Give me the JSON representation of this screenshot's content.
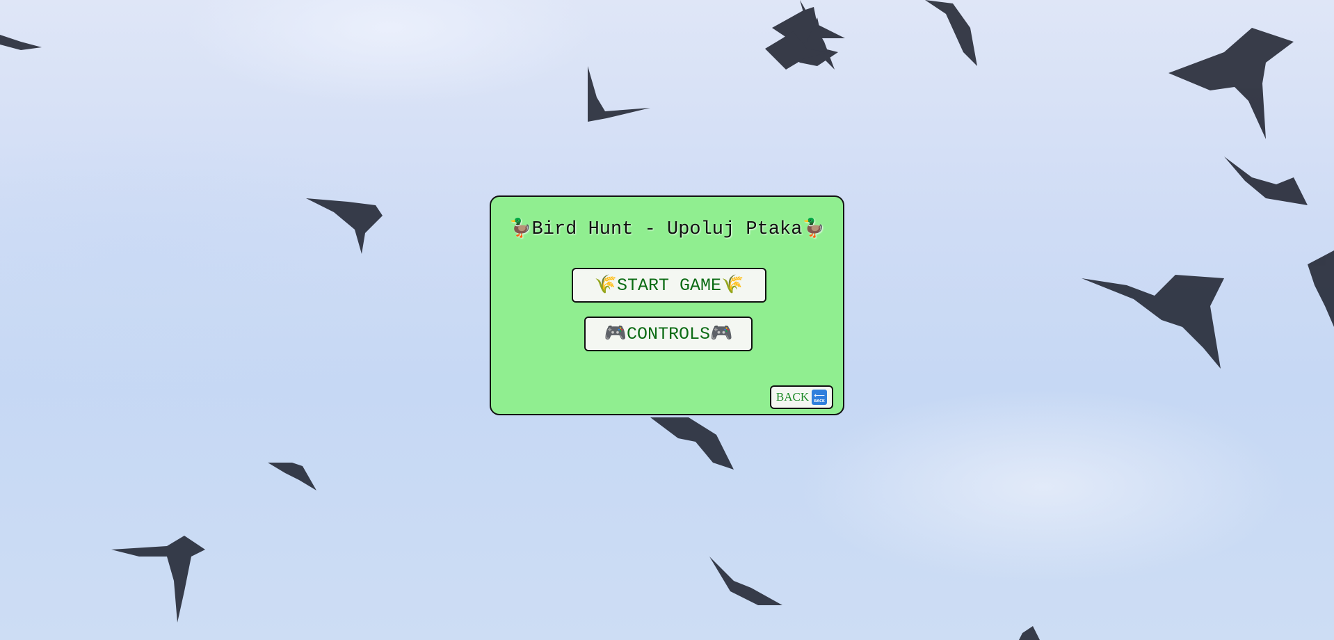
{
  "background": {
    "scene": "flock of birds in sky",
    "sky_color": "#cfdcf5",
    "bird_color": "#1b1e2a"
  },
  "menu": {
    "panel_color": "#90ee90",
    "title": "Bird Hunt - Upoluj Ptaka",
    "title_icon": "duck-icon",
    "title_emoji": "🦆",
    "start_button": {
      "label": "START GAME",
      "icon": "rice-sheaf-icon",
      "emoji": "🌾"
    },
    "controls_button": {
      "label": "CONTROLS",
      "icon": "gamepad-icon",
      "emoji": "🎮"
    },
    "back_button": {
      "label": "BACK",
      "icon": "back-arrow-icon",
      "icon_text": "BACK"
    },
    "accent_text_color": "#0b6b14"
  }
}
